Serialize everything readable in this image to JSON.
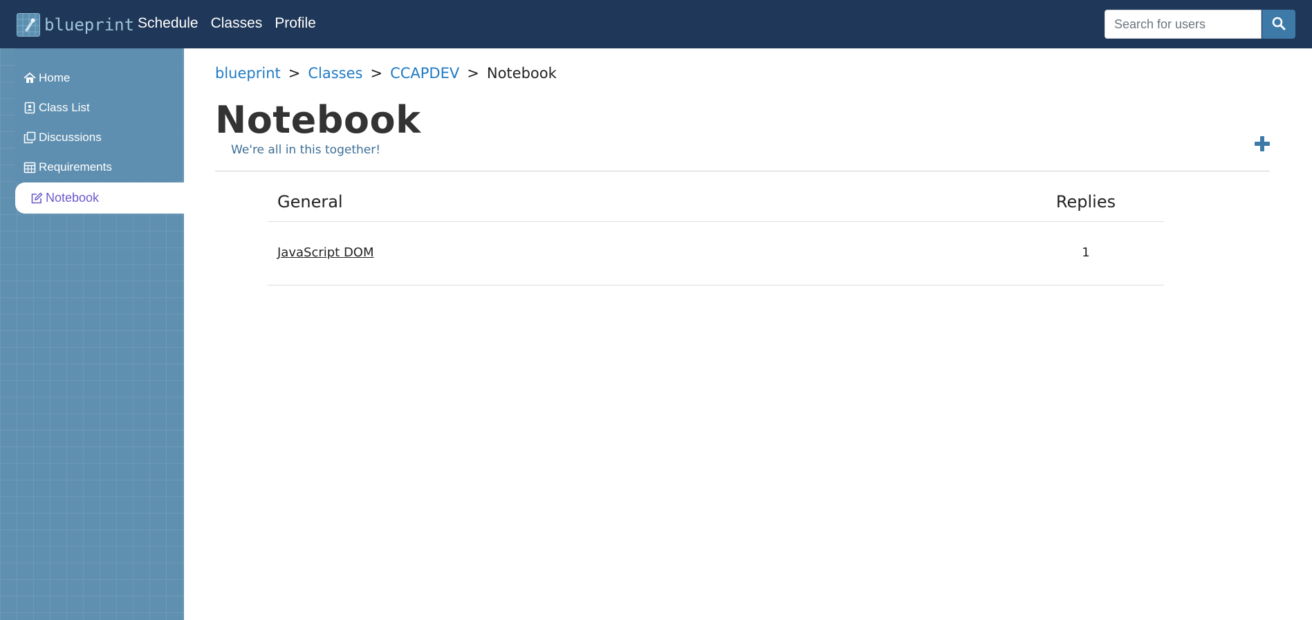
{
  "navbar": {
    "brand": "blueprint",
    "links": [
      "Schedule",
      "Classes",
      "Profile"
    ],
    "search": {
      "placeholder": "Search for users",
      "value": ""
    }
  },
  "sidebar": {
    "items": [
      {
        "label": "Home",
        "icon": "home-icon"
      },
      {
        "label": "Class List",
        "icon": "contact-card-icon"
      },
      {
        "label": "Discussions",
        "icon": "copy-icon"
      },
      {
        "label": "Requirements",
        "icon": "calendar-icon"
      },
      {
        "label": "Notebook",
        "icon": "edit-icon",
        "active": true
      }
    ]
  },
  "breadcrumb": {
    "items": [
      "blueprint",
      "Classes",
      "CCAPDEV"
    ],
    "separator": ">",
    "current": "Notebook"
  },
  "page": {
    "title": "Notebook",
    "subtitle": "We're all in this together!"
  },
  "table": {
    "headers": {
      "general": "General",
      "replies": "Replies"
    },
    "rows": [
      {
        "title": "JavaScript DOM",
        "replies": "1"
      }
    ]
  },
  "colors": {
    "navbar": "#1f3758",
    "sidebar": "#6090b0",
    "link": "#1f7ac4",
    "active_item": "#6a5acd",
    "accent": "#3d7aa8"
  }
}
